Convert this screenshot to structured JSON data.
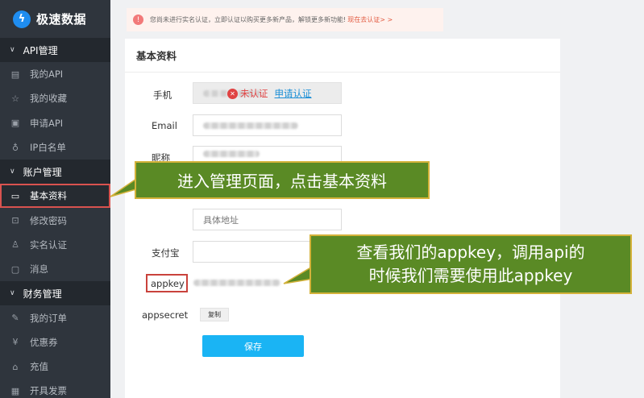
{
  "brand": {
    "name": "极速数据"
  },
  "sidebar": {
    "groups": [
      {
        "title": "API管理",
        "items": [
          {
            "label": "我的API",
            "icon": "api-list-icon"
          },
          {
            "label": "我的收藏",
            "icon": "star-icon"
          },
          {
            "label": "申请API",
            "icon": "apply-icon"
          },
          {
            "label": "IP白名单",
            "icon": "user-icon"
          }
        ]
      },
      {
        "title": "账户管理",
        "items": [
          {
            "label": "基本资料",
            "icon": "profile-card-icon",
            "active": true
          },
          {
            "label": "修改密码",
            "icon": "lock-icon"
          },
          {
            "label": "实名认证",
            "icon": "verify-user-icon"
          },
          {
            "label": "消息",
            "icon": "message-icon"
          }
        ]
      },
      {
        "title": "财务管理",
        "items": [
          {
            "label": "我的订单",
            "icon": "order-icon"
          },
          {
            "label": "优惠券",
            "icon": "coupon-icon"
          },
          {
            "label": "充值",
            "icon": "recharge-icon"
          },
          {
            "label": "开具发票",
            "icon": "invoice-icon"
          }
        ]
      }
    ]
  },
  "notice": {
    "text": "您尚未进行实名认证，立即认证以购买更多新产品，解锁更多新功能!",
    "link": "现在去认证> >"
  },
  "profile": {
    "title": "基本资料",
    "phone_label": "手机",
    "email_label": "Email",
    "nickname_label": "昵称",
    "address_placeholder": "具体地址",
    "alipay_label": "支付宝",
    "appkey_label": "appkey",
    "appsecret_label": "appsecret",
    "unverified": "未认证",
    "apply_verify": "申请认证",
    "copy_label": "复制",
    "save_label": "保存"
  },
  "callouts": {
    "profile_tip": "进入管理页面，点击基本资料",
    "appkey_tip_line1": "查看我们的appkey，调用api的",
    "appkey_tip_line2": "时候我们需要使用此appkey"
  },
  "colors": {
    "sidebar_bg": "#2f353d",
    "accent_blue": "#1ab4f4",
    "callout_green": "#5a8a25",
    "highlight_red": "#c9423c"
  }
}
